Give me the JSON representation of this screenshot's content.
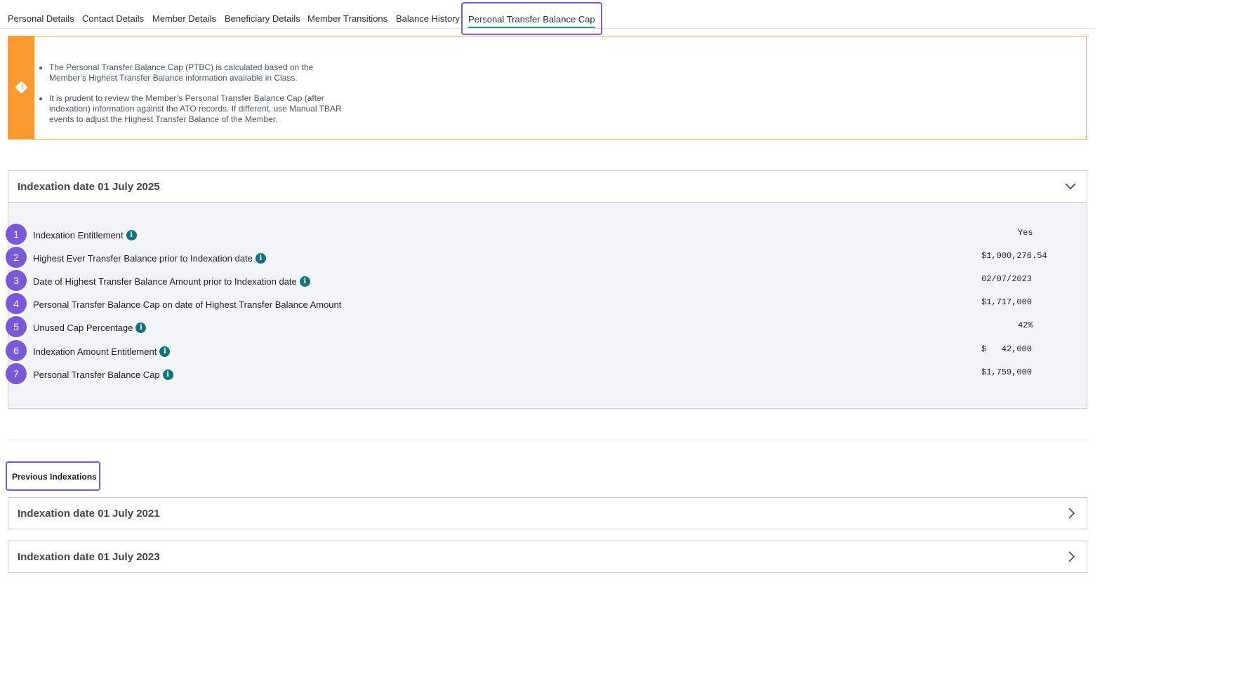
{
  "tabs": [
    {
      "label": "Personal Details"
    },
    {
      "label": "Contact Details"
    },
    {
      "label": "Member Details"
    },
    {
      "label": "Beneficiary Details"
    },
    {
      "label": "Member Transitions"
    },
    {
      "label": "Balance History"
    },
    {
      "label": "Personal Transfer Balance Cap"
    }
  ],
  "active_tab": "Personal Transfer Balance Cap",
  "alert": {
    "icon": "warning-diamond-icon",
    "items": [
      "The Personal Transfer Balance Cap (PTBC) is calculated based on the Member’s Highest Transfer Balance information available in Class.",
      "It is prudent to review the Member’s Personal Transfer Balance Cap (after indexation) information against the ATO records. If different, use Manual TBAR events to adjust the Highest Transfer Balance of the Member."
    ]
  },
  "current_indexation": {
    "title": "Indexation date 01 July 2025",
    "rows": [
      {
        "num": "1",
        "label": "Indexation Entitlement",
        "value": "Yes",
        "info": "i"
      },
      {
        "num": "2",
        "label": "Highest Ever Transfer Balance prior to Indexation date",
        "value": "$1,000,276.54",
        "info": "i"
      },
      {
        "num": "3",
        "label": "Date of Highest Transfer Balance Amount prior to Indexation date",
        "value": "02/07/2023",
        "info": "i"
      },
      {
        "num": "4",
        "label": "Personal Transfer Balance Cap on date of Highest Transfer Balance Amount",
        "value": "$1,717,000",
        "info": ""
      },
      {
        "num": "5",
        "label": "Unused Cap Percentage",
        "value": "42%",
        "info": "i"
      },
      {
        "num": "6",
        "label": "Indexation Amount Entitlement",
        "value": "$   42,000",
        "info": "i"
      },
      {
        "num": "7",
        "label": "Personal Transfer Balance Cap",
        "value": "$1,759,000",
        "info": "i"
      }
    ]
  },
  "previous": {
    "label": "Previous Indexations",
    "items": [
      {
        "title": "Indexation date 01 July 2021"
      },
      {
        "title": "Indexation date 01 July 2023"
      }
    ]
  },
  "colors": {
    "accent": "#7b58d6",
    "warning": "#fa9a31",
    "info": "#12737f",
    "tab_underline": "#1e9e8a"
  }
}
